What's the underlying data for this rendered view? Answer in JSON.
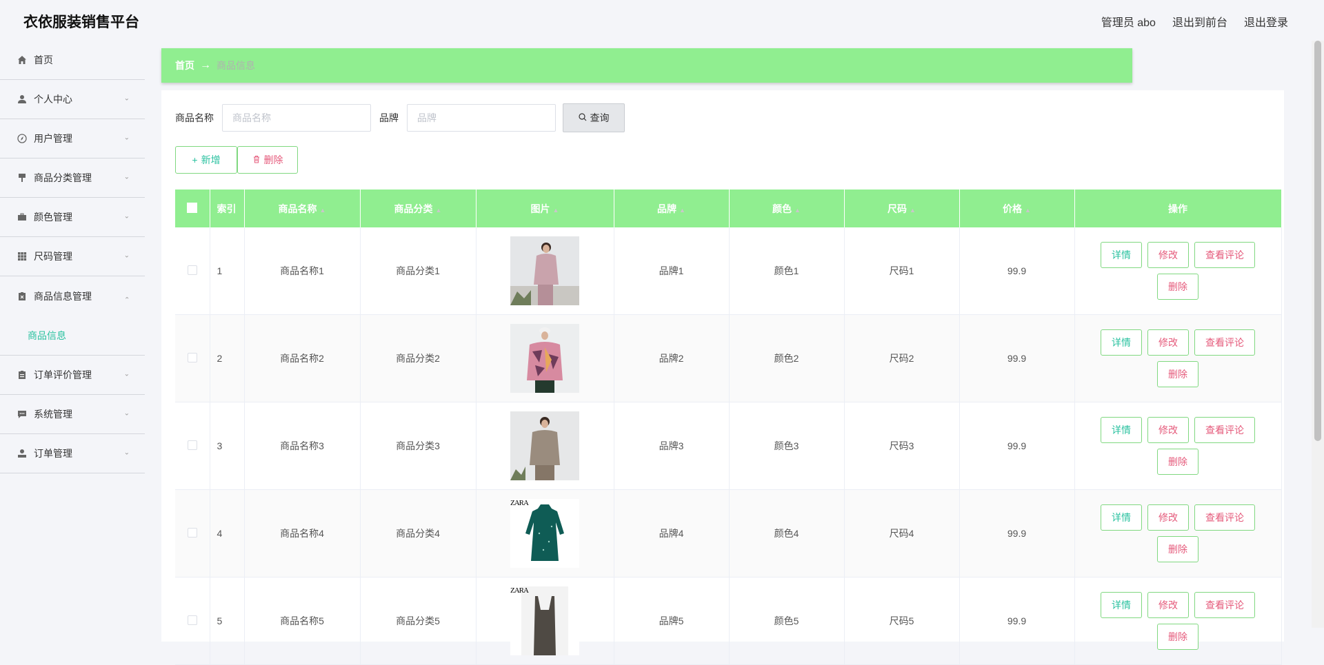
{
  "header": {
    "title": "衣依服装销售平台",
    "admin": "管理员 abo",
    "to_front": "退出到前台",
    "logout": "退出登录"
  },
  "sidebar": {
    "items": [
      {
        "label": "首页",
        "icon": "home-icon"
      },
      {
        "label": "个人中心",
        "icon": "user-icon"
      },
      {
        "label": "用户管理",
        "icon": "compass-icon"
      },
      {
        "label": "商品分类管理",
        "icon": "brush-icon"
      },
      {
        "label": "颜色管理",
        "icon": "suitcase-icon"
      },
      {
        "label": "尺码管理",
        "icon": "grid-icon"
      },
      {
        "label": "商品信息管理",
        "icon": "delete-doc-icon"
      },
      {
        "label": "订单评价管理",
        "icon": "clipboard-icon"
      },
      {
        "label": "系统管理",
        "icon": "chat-icon"
      },
      {
        "label": "订单管理",
        "icon": "user-solid-icon"
      }
    ],
    "submenu": "商品信息"
  },
  "breadcrumb": {
    "home": "首页",
    "current": "商品信息"
  },
  "search": {
    "name_label": "商品名称",
    "name_placeholder": "商品名称",
    "brand_label": "品牌",
    "brand_placeholder": "品牌",
    "query_label": "查询"
  },
  "actions": {
    "add_label": "新增",
    "delete_label": "删除"
  },
  "table": {
    "headers": [
      "索引",
      "商品名称",
      "商品分类",
      "图片",
      "品牌",
      "颜色",
      "尺码",
      "价格",
      "操作"
    ],
    "rows": [
      {
        "index": "1",
        "name": "商品名称1",
        "category": "商品分类1",
        "brand": "品牌1",
        "color": "颜色1",
        "size": "尺码1",
        "price": "99.9"
      },
      {
        "index": "2",
        "name": "商品名称2",
        "category": "商品分类2",
        "brand": "品牌2",
        "color": "颜色2",
        "size": "尺码2",
        "price": "99.9"
      },
      {
        "index": "3",
        "name": "商品名称3",
        "category": "商品分类3",
        "brand": "品牌3",
        "color": "颜色3",
        "size": "尺码3",
        "price": "99.9"
      },
      {
        "index": "4",
        "name": "商品名称4",
        "category": "商品分类4",
        "brand": "品牌4",
        "color": "颜色4",
        "size": "尺码4",
        "price": "99.9"
      },
      {
        "index": "5",
        "name": "商品名称5",
        "category": "商品分类5",
        "brand": "品牌5",
        "color": "颜色5",
        "size": "尺码5",
        "price": "99.9"
      }
    ],
    "op_labels": {
      "detail": "详情",
      "edit": "修改",
      "review": "查看评论",
      "remove": "删除"
    },
    "image_logo": "ZARA"
  },
  "colors": {
    "accent_green": "#90ee90",
    "teal_text": "#2bc2a0",
    "pink_text": "#e55a7b"
  }
}
